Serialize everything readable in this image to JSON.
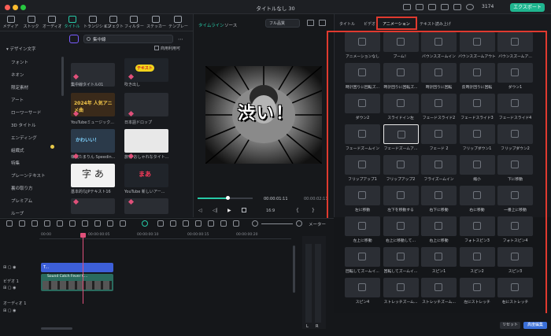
{
  "window": {
    "title": "タイトルなし 30",
    "coins": "3174",
    "export_label": "エクスポート"
  },
  "top_tabs": [
    {
      "label": "メディア",
      "icon": "media-icon"
    },
    {
      "label": "ストック",
      "icon": "stock-icon"
    },
    {
      "label": "オーディオ",
      "icon": "audio-icon"
    },
    {
      "label": "タイトル",
      "icon": "title-icon",
      "active": true
    },
    {
      "label": "トランジション",
      "icon": "transition-icon"
    },
    {
      "label": "エフェクト",
      "icon": "effect-icon"
    },
    {
      "label": "フィルター",
      "icon": "filter-icon"
    },
    {
      "label": "ステッカー",
      "icon": "sticker-icon"
    },
    {
      "label": "テンプレー",
      "icon": "template-icon"
    }
  ],
  "categories": [
    "デザイン文字",
    "フォント",
    "ネオン",
    "限定素材",
    "アート",
    "ローワーサード",
    "3D タイトル",
    "エンディング",
    "組織式",
    "特集",
    "プレーンテキスト",
    "裏の取り方",
    "プレミアム",
    "ループ"
  ],
  "search": {
    "value": "集中線"
  },
  "assets": {
    "commercial_label": "商用利用可",
    "items": [
      {
        "label": "集中線タイトル01",
        "overlay": ""
      },
      {
        "label": "吹き出し",
        "overlay": "テキスト"
      },
      {
        "label": "YouTubeミュージック...",
        "overlay": "2024年 人気アニメ曲"
      },
      {
        "label": "日本語ドロップ",
        "overlay": ""
      },
      {
        "label": "株式たまりん Speedin...",
        "overlay": "かわいい！"
      },
      {
        "label": "旅行 おしゃれなタイト...",
        "overlay": ""
      },
      {
        "label": "基本的なJPテキスト16",
        "overlay": "字 あ"
      },
      {
        "label": "YouTube 新しいアー...",
        "overlay": "まあ"
      }
    ]
  },
  "preview": {
    "tabs": [
      "タイムライン",
      "ソース"
    ],
    "quality": "フル品質",
    "overlay_text": "渋い！",
    "time_current": "00:00:01:11",
    "time_total": "00:00:02:11",
    "ratio": "16:9"
  },
  "right": {
    "tabs": [
      "タイトル",
      "ビデオ",
      "アニメーション",
      "テキスト読み上げ"
    ],
    "active_tab": "アニメーション",
    "animations": [
      "アニメーションなし",
      "ブーム！",
      "バウンスズームイン",
      "バウンスズームアウト",
      "バウンスズームア...",
      "時計回りに回転ズ...",
      "時計回りに回転ズ...",
      "時計回りに回転",
      "反時計回りに回転",
      "ダウン1",
      "ダウン2",
      "スライドイン左",
      "フェードスライド2",
      "フェードスライド3",
      "フェードスライド4",
      "フェードズームイン",
      "フェードズームア...",
      "フェード 2",
      "フリップダウン1",
      "フリップダウン2",
      "フリップアップ1",
      "フリップアップ2",
      "フライズームイン",
      "縮小",
      "下に移動",
      "左に移動",
      "左下を移動する",
      "右下に移動",
      "右に移動",
      "一番上に移動",
      "左上に移動",
      "右上に移動して...",
      "右上に移動",
      "フォトスピン3",
      "フォトスピン4",
      "回転してズームイ...",
      "回転してズームイ...",
      "スピン1",
      "スピン2",
      "スピン3",
      "スピン4",
      "ストレッチズーム...",
      "ストレッチズーム...",
      "左にストレッチ",
      "右にストレッチ"
    ],
    "selected_index": 16,
    "reset_label": "リセット",
    "apply_label": "高度編集"
  },
  "timeline": {
    "ticks": [
      "00:00",
      "00:00:00:05",
      "00:00:00:10",
      "00:00:00:15",
      "00:00:00:20"
    ],
    "tracks": [
      {
        "name": "",
        "clip": "T..."
      },
      {
        "name": "ビデオ 1",
        "clip": "Sound Catch Fever C..."
      },
      {
        "name": "オーディオ 1",
        "clip": ""
      }
    ],
    "meter_label": "メーター",
    "meter_lr": [
      "L",
      "R"
    ]
  }
}
